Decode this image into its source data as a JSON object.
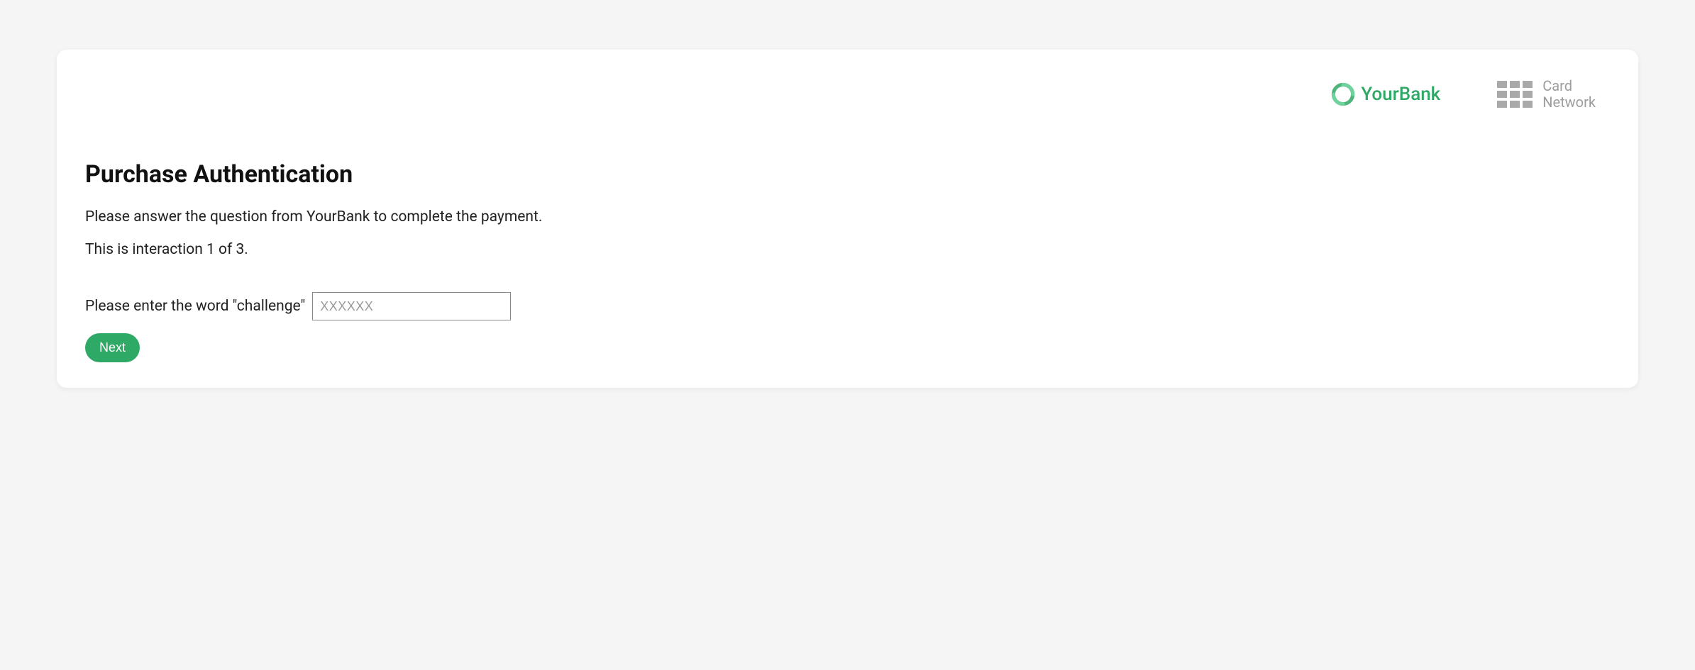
{
  "logos": {
    "bank": {
      "text": "YourBank"
    },
    "network": {
      "line1": "Card",
      "line2": "Network"
    }
  },
  "heading": "Purchase Authentication",
  "instruction": "Please answer the question from YourBank to complete the payment.",
  "step_indicator": "This is interaction 1 of 3.",
  "form": {
    "label": "Please enter the word \"challenge\"",
    "placeholder": "XXXXXX",
    "next_label": "Next"
  }
}
